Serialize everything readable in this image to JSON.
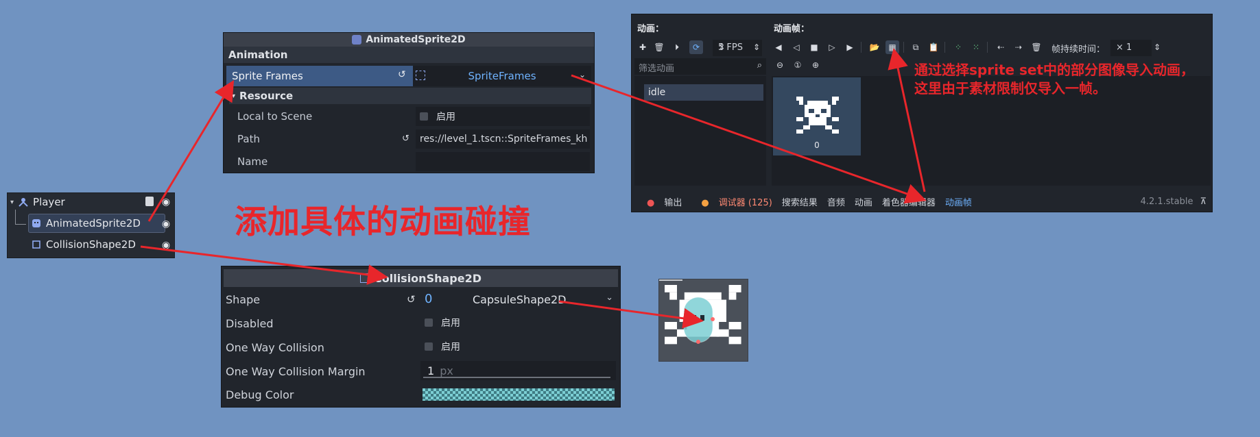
{
  "scene_tree": {
    "root": {
      "label": "Player",
      "icon": "player-node-icon"
    },
    "children": [
      {
        "label": "AnimatedSprite2D",
        "icon": "animated-sprite-icon",
        "selected": true
      },
      {
        "label": "CollisionShape2D",
        "icon": "collision-shape-icon"
      }
    ]
  },
  "inspector_anim": {
    "title": "AnimatedSprite2D",
    "section": "Animation",
    "sprite_frames_label": "Sprite Frames",
    "sprite_frames_value": "SpriteFrames",
    "resource_label": "Resource",
    "local_to_scene_label": "Local to Scene",
    "local_to_scene_value": "启用",
    "path_label": "Path",
    "path_value": "res://level_1.tscn::SpriteFrames_kh",
    "name_label": "Name"
  },
  "anim_panel": {
    "animations_header": "动画：",
    "frames_header": "动画帧：",
    "fps": "5 FPS",
    "frame_duration_label": "帧持续时间：",
    "frame_duration_value": "× 1",
    "filter_placeholder": "筛选动画",
    "animation_items": [
      "idle"
    ],
    "frame_index": "0",
    "bottom_tabs": [
      "输出",
      "调试器 (125)",
      "搜索结果",
      "音频",
      "动画",
      "着色器编辑器",
      "动画帧"
    ],
    "version": "4.2.1.stable"
  },
  "annotations": {
    "import_note_line1": "通过选择sprite set中的部分图像导入动画，",
    "import_note_line2": "这里由于素材限制仅导入一帧。",
    "main_note": "添加具体的动画碰撞"
  },
  "inspector_col": {
    "title": "CollisionShape2D",
    "shape_label": "Shape",
    "shape_index": "0",
    "shape_value": "CapsuleShape2D",
    "disabled_label": "Disabled",
    "disabled_value": "启用",
    "one_way_label": "One Way Collision",
    "one_way_value": "启用",
    "margin_label": "One Way Collision Margin",
    "margin_value": "1",
    "margin_unit": "px",
    "debug_color_label": "Debug Color"
  },
  "colors": {
    "background": "#7093c1",
    "annotation_red": "#e8262b",
    "accent_blue": "#6fb3ff",
    "debug_color": "#7ccfd4"
  }
}
